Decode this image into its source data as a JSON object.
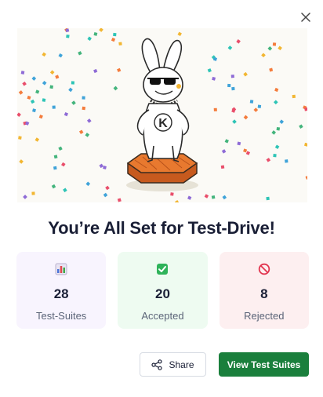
{
  "dialog": {
    "title": "You’re All Set for Test-Drive!",
    "close_icon": "close-icon"
  },
  "hero": {
    "mascot_letter": "K",
    "illustration": "celebration-mascot-on-podium"
  },
  "stats": [
    {
      "icon": "bar-chart-icon",
      "value": "28",
      "label": "Test-Suites",
      "bg": "#f8f4fe"
    },
    {
      "icon": "check-box-icon",
      "value": "20",
      "label": "Accepted",
      "bg": "#eefbf1"
    },
    {
      "icon": "blocked-icon",
      "value": "8",
      "label": "Rejected",
      "bg": "#fdeff0"
    }
  ],
  "actions": {
    "share_label": "Share",
    "share_icon": "share-icon",
    "primary_label": "View Test Suites"
  },
  "colors": {
    "primary": "#1a7f3c",
    "title": "#1a1f36"
  }
}
